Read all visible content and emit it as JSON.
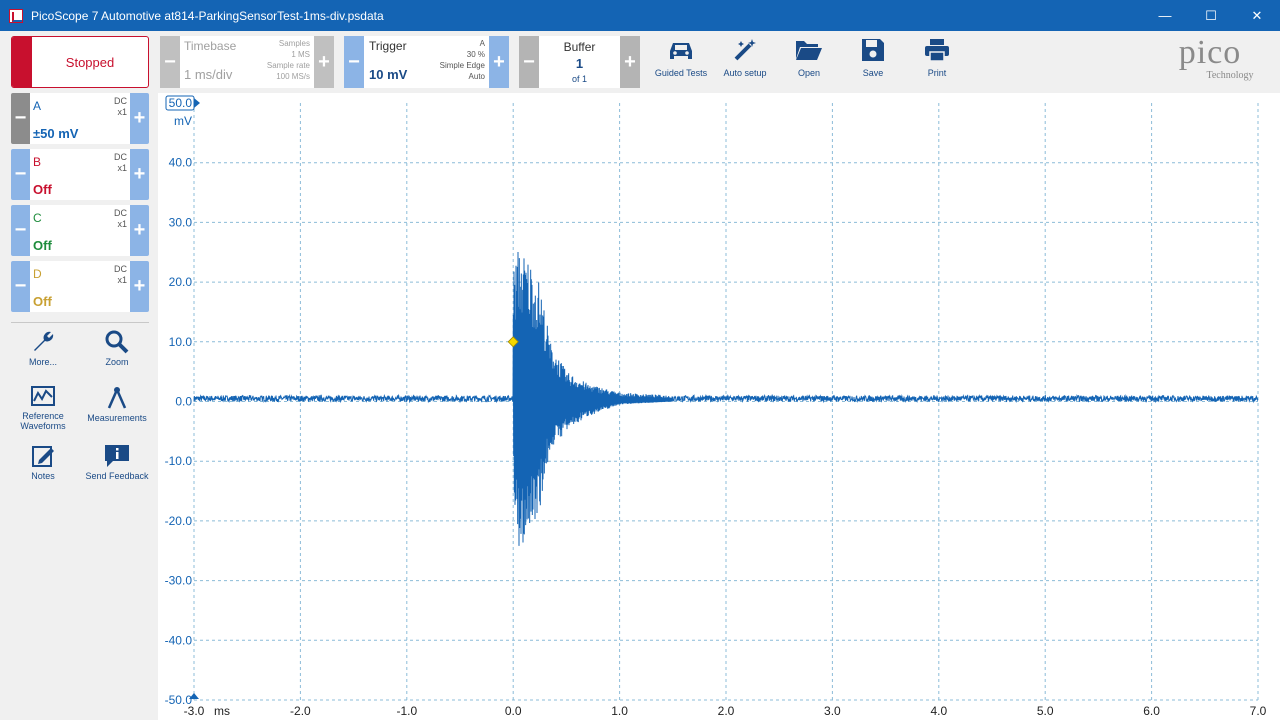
{
  "window": {
    "title": "PicoScope 7 Automotive at814-ParkingSensorTest-1ms-div.psdata",
    "minimize": "—",
    "maximize": "☐",
    "close": "✕"
  },
  "run_button": {
    "label": "Stopped"
  },
  "channels": [
    {
      "letter": "A",
      "coupling": "DC",
      "probe": "x1",
      "range": "±50 mV",
      "color": "#1464b4",
      "enabled": true
    },
    {
      "letter": "B",
      "coupling": "DC",
      "probe": "x1",
      "range": "Off",
      "color": "#c8102e",
      "enabled": false
    },
    {
      "letter": "C",
      "coupling": "DC",
      "probe": "x1",
      "range": "Off",
      "color": "#1e8c3c",
      "enabled": false
    },
    {
      "letter": "D",
      "coupling": "DC",
      "probe": "x1",
      "range": "Off",
      "color": "#c8a032",
      "enabled": false
    }
  ],
  "sidebar_tools": {
    "more": "More...",
    "zoom": "Zoom",
    "reference": "Reference Waveforms",
    "measurements": "Measurements",
    "notes": "Notes",
    "feedback": "Send Feedback"
  },
  "timebase": {
    "label": "Timebase",
    "value": "1 ms/div",
    "samples_label": "Samples",
    "samples_value": "1 MS",
    "rate_label": "Sample rate",
    "rate_value": "100 MS/s"
  },
  "trigger": {
    "label": "Trigger",
    "value": "10 mV",
    "source": "A",
    "position": "30 %",
    "type": "Simple Edge",
    "mode": "Auto"
  },
  "buffer": {
    "label": "Buffer",
    "value": "1",
    "of": "of 1"
  },
  "toolbar": {
    "guided_tests": "Guided Tests",
    "auto_setup": "Auto setup",
    "open": "Open",
    "save": "Save",
    "print": "Print"
  },
  "logo": {
    "brand": "pico",
    "tagline": "Technology"
  },
  "accent_color": "#1464b4",
  "chart_data": {
    "type": "line",
    "x_unit": "ms",
    "y_unit": "mV",
    "xlim": [
      -3.0,
      7.0
    ],
    "ylim": [
      -50.0,
      50.0
    ],
    "x_ticks": [
      "-3.0",
      "-2.0",
      "-1.0",
      "0.0",
      "1.0",
      "2.0",
      "3.0",
      "4.0",
      "5.0",
      "6.0",
      "7.0"
    ],
    "y_ticks": [
      "50.0",
      "40.0",
      "30.0",
      "20.0",
      "10.0",
      "0.0",
      "-10.0",
      "-20.0",
      "-30.0",
      "-40.0",
      "-50.0"
    ],
    "grid": true,
    "trigger_marker": {
      "x": 0.0,
      "y": 10.0
    },
    "series": [
      {
        "channel": "A",
        "color": "#1464b4",
        "description": "baseline ~0.5 mV, ultrasonic burst starting at 0.0 ms peaking about +26/-26 mV near 0.05 ms, decaying to baseline by about 1.5 ms",
        "baseline_mV": 0.5,
        "noise_mV": 0.5,
        "burst": [
          {
            "x": 0.0,
            "max": 22.0,
            "min": -15.0
          },
          {
            "x": 0.05,
            "max": 26.0,
            "min": -26.0
          },
          {
            "x": 0.15,
            "max": 24.0,
            "min": -22.0
          },
          {
            "x": 0.25,
            "max": 20.0,
            "min": -18.0
          },
          {
            "x": 0.35,
            "max": 10.0,
            "min": -8.0
          },
          {
            "x": 0.5,
            "max": 5.0,
            "min": -5.0
          },
          {
            "x": 0.7,
            "max": 3.0,
            "min": -2.5
          },
          {
            "x": 1.0,
            "max": 1.5,
            "min": -0.5
          },
          {
            "x": 1.5,
            "max": 1.0,
            "min": 0.0
          }
        ]
      }
    ]
  }
}
